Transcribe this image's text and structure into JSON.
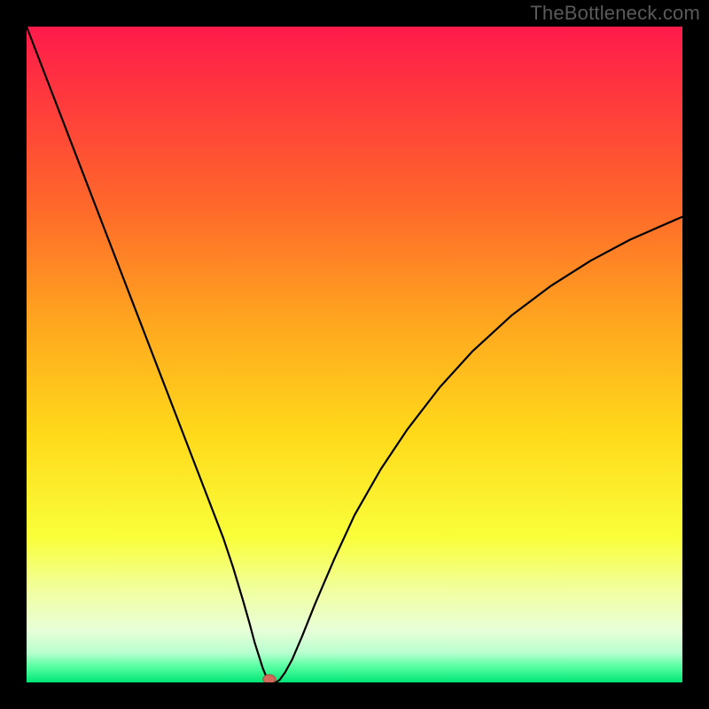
{
  "watermark": "TheBottleneck.com",
  "chart_data": {
    "type": "line",
    "title": "",
    "xlabel": "",
    "ylabel": "",
    "xlim": [
      0,
      100
    ],
    "ylim": [
      0,
      100
    ],
    "background_gradient": {
      "stops": [
        {
          "offset": 0.0,
          "color": "#ff1a4b"
        },
        {
          "offset": 0.12,
          "color": "#ff3c3c"
        },
        {
          "offset": 0.28,
          "color": "#ff6a2a"
        },
        {
          "offset": 0.45,
          "color": "#ffa61f"
        },
        {
          "offset": 0.62,
          "color": "#ffd91a"
        },
        {
          "offset": 0.78,
          "color": "#f9ff3a"
        },
        {
          "offset": 0.86,
          "color": "#f1ffa0"
        },
        {
          "offset": 0.92,
          "color": "#e8ffd8"
        },
        {
          "offset": 0.955,
          "color": "#b8ffcf"
        },
        {
          "offset": 0.975,
          "color": "#5affa3"
        },
        {
          "offset": 1.0,
          "color": "#00e676"
        }
      ]
    },
    "series": [
      {
        "name": "bottleneck-curve",
        "color": "#000000",
        "stroke_width": 2.2,
        "x": [
          0,
          2.5,
          5,
          7.5,
          10,
          12.5,
          15,
          17.5,
          20,
          22.5,
          25,
          27.5,
          30,
          31.5,
          33,
          34,
          34.8,
          35.5,
          36,
          36.5,
          37,
          37.5,
          38,
          38.6,
          39.4,
          40.5,
          42,
          44,
          47,
          50,
          54,
          58,
          63,
          68,
          74,
          80,
          86,
          92,
          97,
          100
        ],
        "y": [
          100,
          93.5,
          87,
          80.5,
          74,
          67.5,
          61,
          54.5,
          48,
          41.5,
          35,
          28.5,
          22,
          17.5,
          12.5,
          9,
          6,
          3.8,
          2.2,
          1.0,
          0.3,
          0.0,
          0.0,
          0.4,
          1.5,
          3.5,
          7,
          12,
          19,
          25.5,
          32.5,
          38.5,
          45,
          50.5,
          56,
          60.5,
          64.3,
          67.5,
          69.7,
          71
        ]
      }
    ],
    "marker": {
      "name": "optimum-marker",
      "x": 37.0,
      "y": 0.5,
      "rx": 7,
      "ry": 5,
      "fill": "#d26a5c",
      "stroke": "#b04a3c"
    }
  }
}
